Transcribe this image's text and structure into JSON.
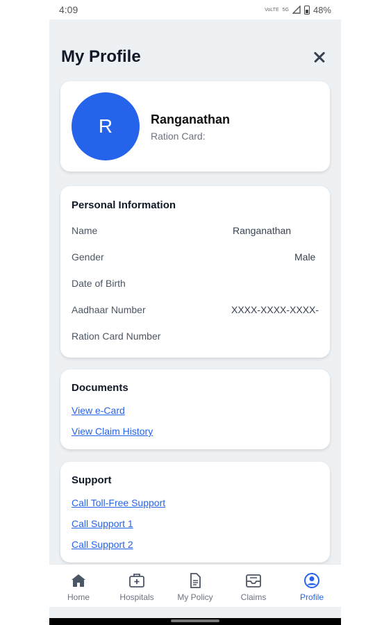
{
  "status_bar": {
    "time": "4:09",
    "net1": "VoLTE",
    "net2": "5G",
    "battery": "48%"
  },
  "header": {
    "title": "My Profile"
  },
  "profile": {
    "initial": "R",
    "name": "Ranganathan",
    "ration_card_label": "Ration Card:"
  },
  "personal_info": {
    "title": "Personal Information",
    "rows": [
      {
        "label": "Name",
        "value": "Ranganathan"
      },
      {
        "label": "Gender",
        "value": "Male"
      },
      {
        "label": "Date of Birth",
        "value": ""
      },
      {
        "label": "Aadhaar Number",
        "value": "XXXX-XXXX-XXXX-"
      },
      {
        "label": "Ration Card Number",
        "value": ""
      }
    ]
  },
  "documents": {
    "title": "Documents",
    "links": [
      "View e-Card",
      "View Claim History"
    ]
  },
  "support": {
    "title": "Support",
    "links": [
      "Call Toll-Free Support",
      "Call Support 1",
      "Call Support 2"
    ]
  },
  "bottom_nav": {
    "items": [
      {
        "label": "Home",
        "icon": "home-icon"
      },
      {
        "label": "Hospitals",
        "icon": "hospital-icon"
      },
      {
        "label": "My Policy",
        "icon": "document-icon"
      },
      {
        "label": "Claims",
        "icon": "inbox-icon"
      },
      {
        "label": "Profile",
        "icon": "user-circle-icon",
        "active": true
      }
    ]
  },
  "colors": {
    "accent": "#2563eb",
    "background": "#eef1f4",
    "card": "#ffffff"
  }
}
